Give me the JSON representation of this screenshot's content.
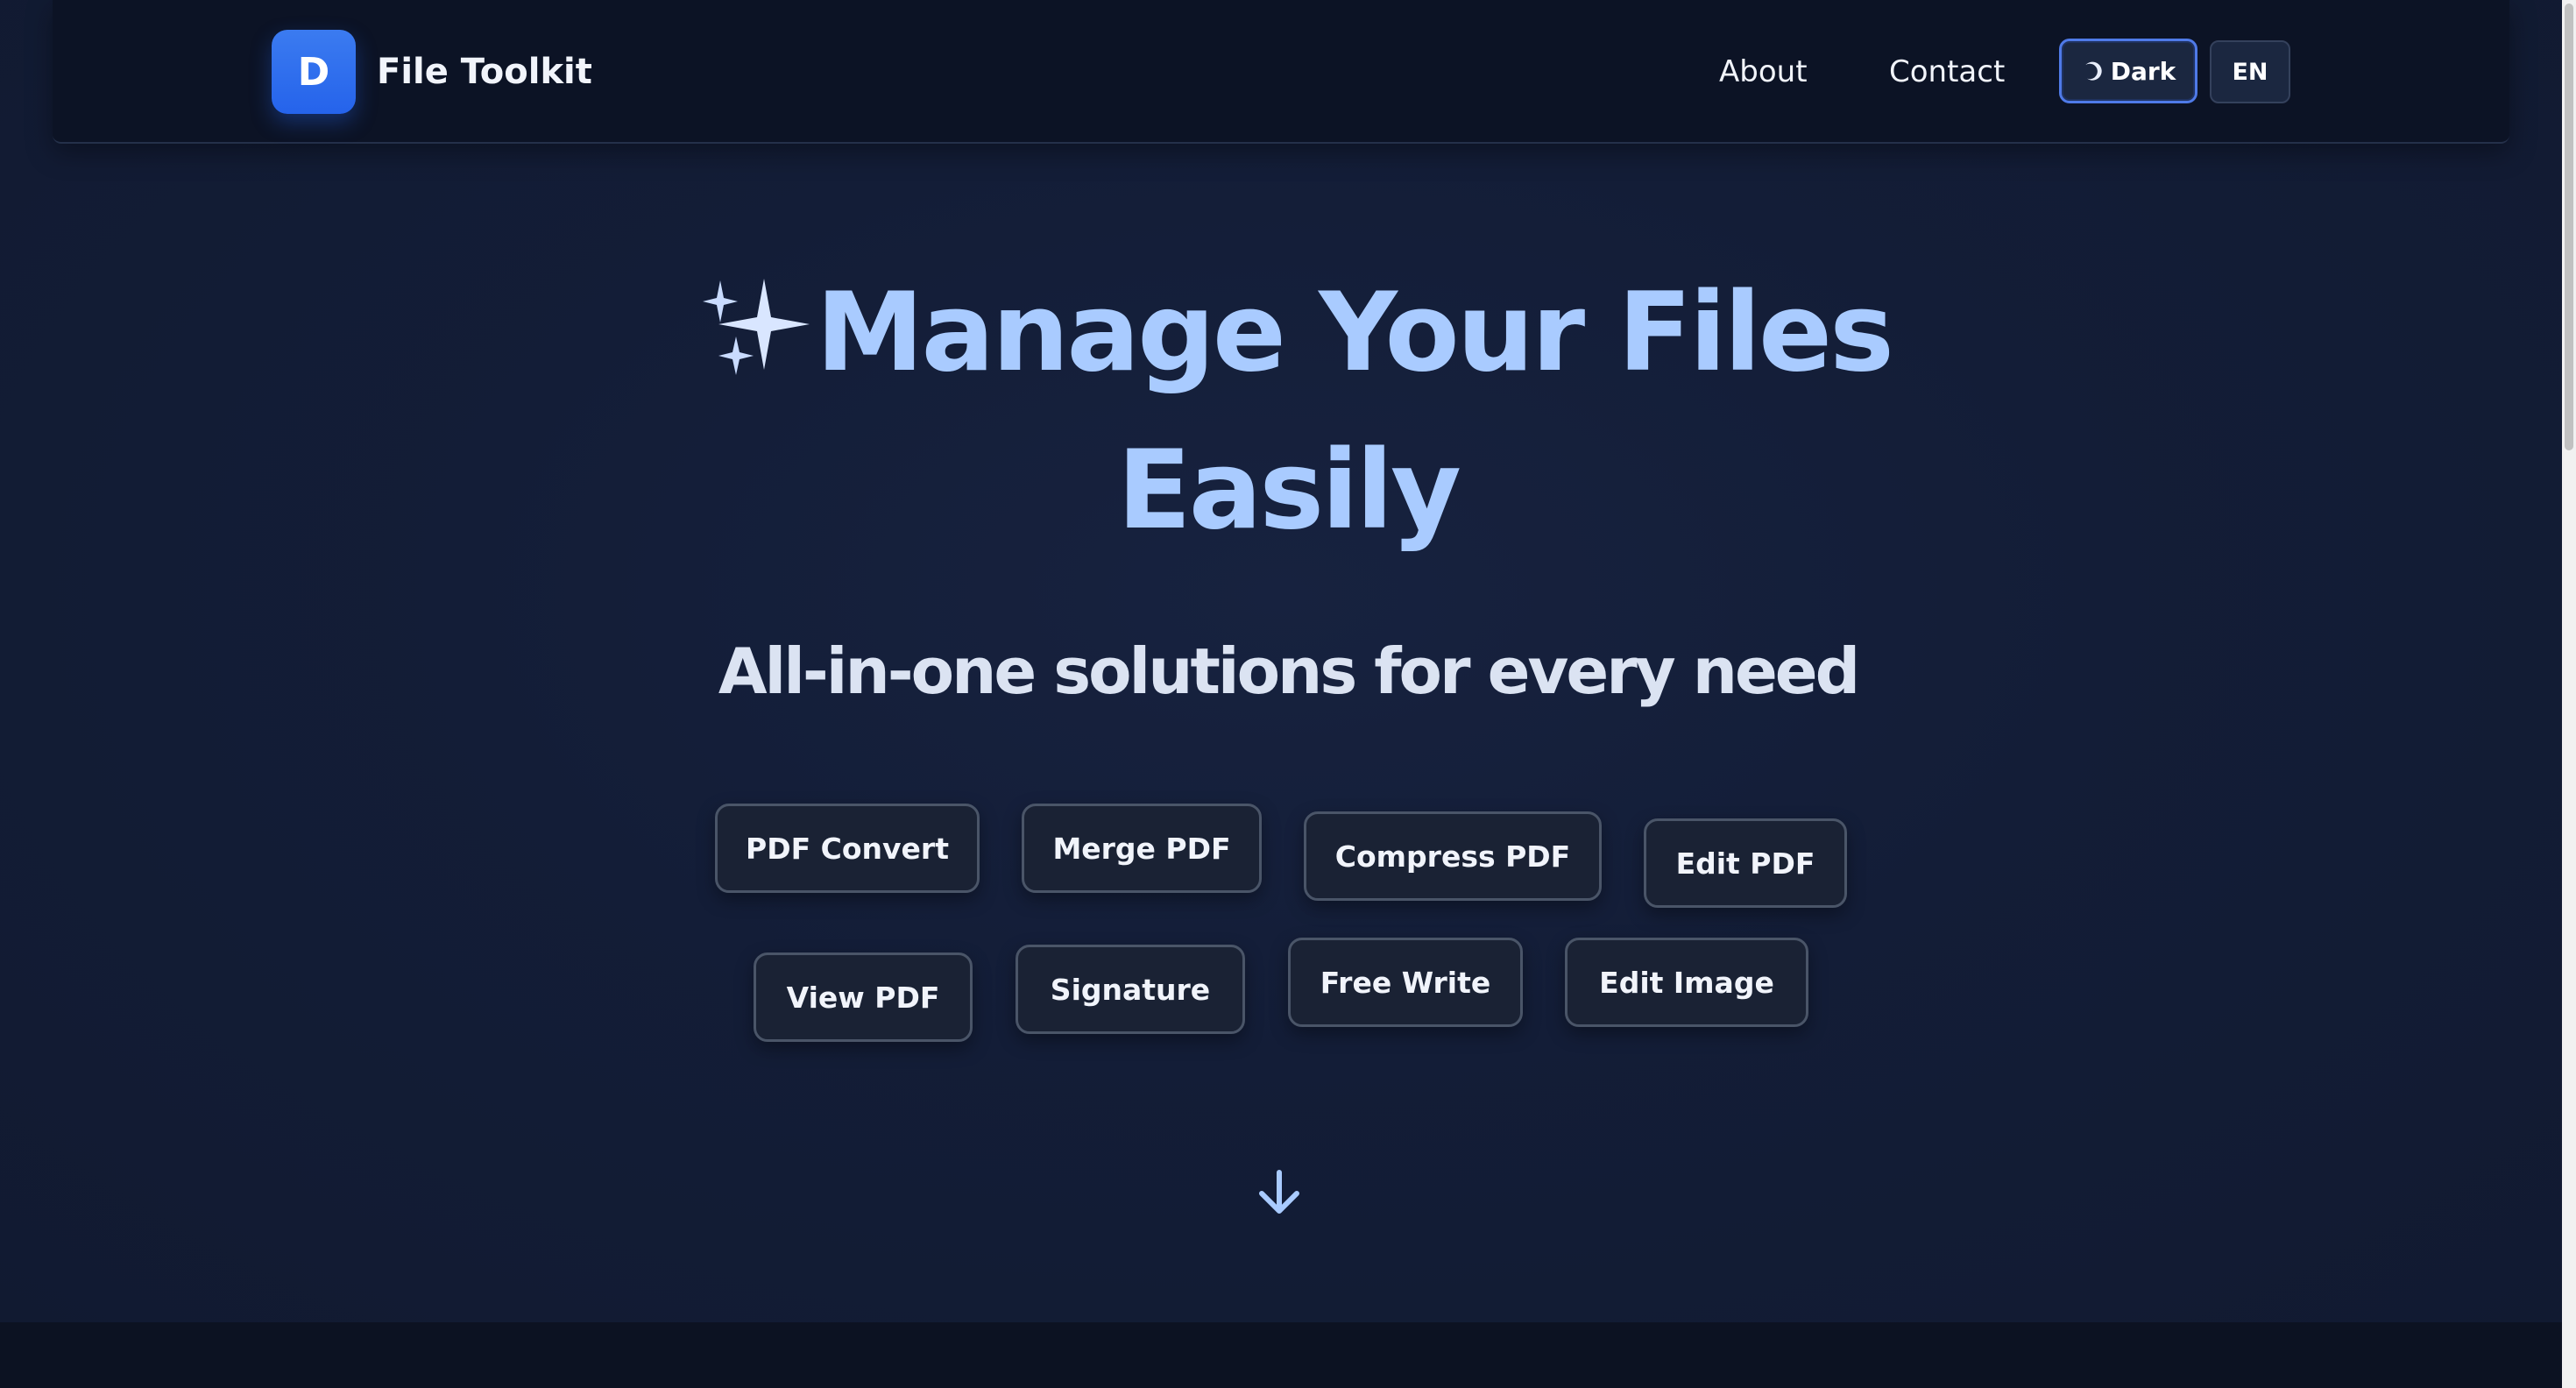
{
  "brand": {
    "logo_letter": "D",
    "name": "File Toolkit"
  },
  "nav": {
    "links": [
      "About",
      "Contact"
    ],
    "theme_label": "Dark",
    "language_label": "EN"
  },
  "hero": {
    "title_line1": "Manage Your Files",
    "title_line2": "Easily",
    "subtitle": "All-in-one solutions for every need"
  },
  "tools": [
    "PDF Convert",
    "Merge PDF",
    "Compress PDF",
    "Edit PDF",
    "View PDF",
    "Signature",
    "Free Write",
    "Edit Image"
  ],
  "icons": {
    "hero": "sparkles-icon",
    "theme": "moon-icon",
    "scroll": "arrow-down-icon"
  },
  "colors": {
    "accent": "#2563eb",
    "title": "#a9cbff",
    "background": "#131d37"
  }
}
